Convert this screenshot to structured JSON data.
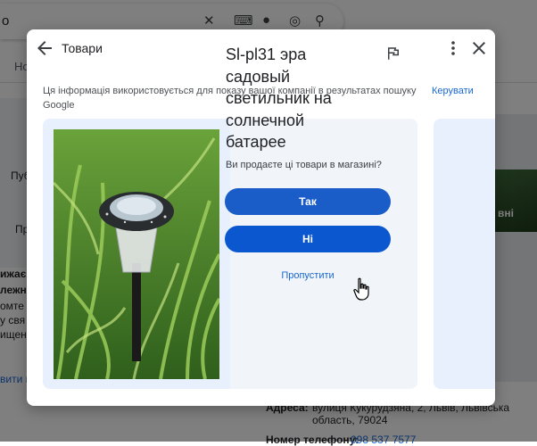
{
  "background": {
    "search_query": "о",
    "tabs_fragment": "Но",
    "left_labels": [
      "Пуб",
      "Пр"
    ],
    "left_text_lines": [
      "ижає",
      "лежн",
      "омте к",
      "у свя",
      "ищених"
    ],
    "left_link": "вити г",
    "right_img_caption": "вні",
    "address_label": "Адреса:",
    "address_value": "вулиця Кукурудзяна, 2, Львів, Львівська область, 79024",
    "phone_label": "Номер телефону:",
    "phone_value": "098 537 7577"
  },
  "dialog": {
    "title": "Товари",
    "info_text": "Ця інформація використовується для показу вашої компанії в результатах пошуку Google",
    "manage_label": "Керувати",
    "product": {
      "title": "Sl-pl31 эра садовый светильник на солнечной батарее",
      "question": "Ви продаєте ці товари в магазині?",
      "yes_label": "Так",
      "no_label": "Ні",
      "skip_label": "Пропустити"
    }
  },
  "colors": {
    "accent": "#0b57d0",
    "link": "#1967d2",
    "card_bg": "#e8f0fe"
  },
  "icons": {
    "back": "arrow-left-icon",
    "more": "more-vert-icon",
    "close": "close-icon",
    "flag": "flag-icon"
  }
}
